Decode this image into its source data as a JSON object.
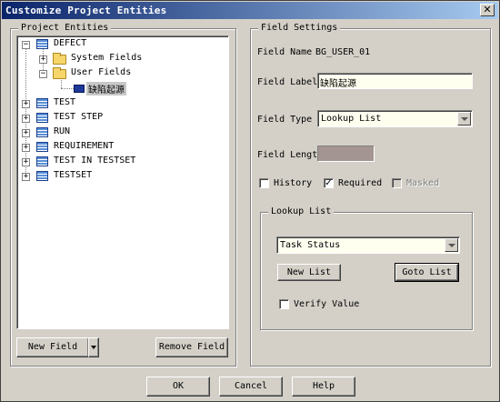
{
  "window": {
    "title": "Customize Project Entities",
    "close_glyph": "✕"
  },
  "left_panel": {
    "group_label": "Project Entities",
    "tree": [
      {
        "label": "DEFECT",
        "expander": "−"
      },
      {
        "label": "System Fields",
        "expander": "+"
      },
      {
        "label": "User Fields",
        "expander": "−"
      },
      {
        "label": "缺陷起源"
      },
      {
        "label": "TEST",
        "expander": "+"
      },
      {
        "label": "TEST STEP",
        "expander": "+"
      },
      {
        "label": "RUN",
        "expander": "+"
      },
      {
        "label": "REQUIREMENT",
        "expander": "+"
      },
      {
        "label": "TEST IN TESTSET",
        "expander": "+"
      },
      {
        "label": "TESTSET",
        "expander": "+"
      }
    ],
    "new_field_label": "New Field",
    "remove_field_label": "Remove Field"
  },
  "field_settings": {
    "group_label": "Field Settings",
    "field_name_label": "Field Name",
    "field_name_value": "BG_USER_01",
    "field_label_label": "Field Label",
    "field_label_value": "缺陷起源",
    "field_type_label": "Field Type",
    "field_type_value": "Lookup List",
    "field_length_label": "Field Lengt",
    "history_label": "History",
    "history_checked": false,
    "required_label": "Required",
    "required_checked": true,
    "masked_label": "Masked",
    "masked_checked": false,
    "lookup": {
      "group_label": "Lookup List",
      "selected": "Task Status",
      "new_list_label": "New List",
      "goto_list_label": "Goto List",
      "verify_label": "Verify Value",
      "verify_checked": false
    }
  },
  "footer": {
    "ok_label": "OK",
    "cancel_label": "Cancel",
    "help_label": "Help"
  },
  "icons": {
    "check_glyph": "✓"
  },
  "colors": {
    "title_start": "#0a246a",
    "title_end": "#a6caf0",
    "field_icon": "#1d3a9a",
    "length_box": "#a39591"
  }
}
